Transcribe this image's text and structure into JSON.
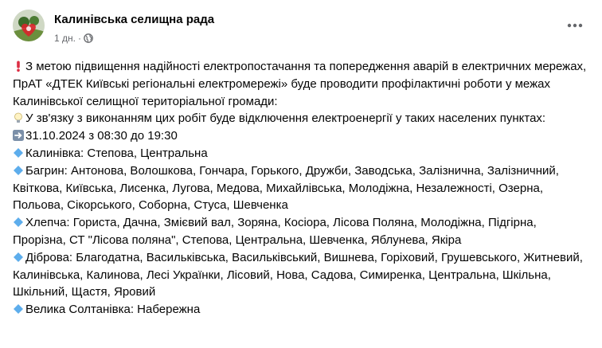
{
  "post": {
    "author": "Калинівська селищна рада",
    "time": "1 дн.",
    "dot": "·",
    "lines": [
      {
        "emoji": "exclamation-icon",
        "text": "З метою підвищення надійності електропостачання та попередження аварій в електричних мережах, ПрАТ «ДТЕК Київські регіональні електромережі» буде проводити профілактичні роботи у межах Калинівської селищної територіальної громади:"
      },
      {
        "emoji": "lightbulb-icon",
        "text": "У зв'язку з виконанням цих робіт буде відключення електроенергії у таких населених пунктах:"
      },
      {
        "emoji": "arrow-right-icon",
        "text": "31.10.2024 з 08:30 до 19:30"
      },
      {
        "emoji": "blue-diamond-icon",
        "text": "Калинівка: Степова, Центральна"
      },
      {
        "emoji": "blue-diamond-icon",
        "text": "Багрин: Антонова, Волошкова, Гончара, Горького, Дружби, Заводська, Залізнична, Залізничний, Квіткова, Київська, Лисенка, Лугова, Медова, Михайлівська, Молодіжна, Незалежності, Озерна, Польова, Сікорського, Соборна, Стуса, Шевченка"
      },
      {
        "emoji": "blue-diamond-icon",
        "text": "Хлепча: Гориста, Дачна, Змієвий вал, Зоряна, Косіора, Лісова Поляна, Молодіжна, Підгірна, Прорізна, СТ \"Лісова поляна\", Степова, Центральна, Шевченка, Яблунева, Якіра"
      },
      {
        "emoji": "blue-diamond-icon",
        "text": "Діброва: Благодатна, Васильківська, Васильківський, Вишнева, Горіховий, Грушевського, Житневий, Калинівська, Калинова, Лесі Українки, Лісовий, Нова, Садова, Симиренка, Центральна, Шкільна, Шкільний, Щастя, Яровий"
      },
      {
        "emoji": "blue-diamond-icon",
        "text": "Велика Солтанівка: Набережна"
      }
    ]
  },
  "colors": {
    "text": "#050505",
    "secondary": "#65676b",
    "exclamation": "#dd2e44",
    "diamond": "#5dadec",
    "arrow_bg": "#7b8fa8"
  }
}
